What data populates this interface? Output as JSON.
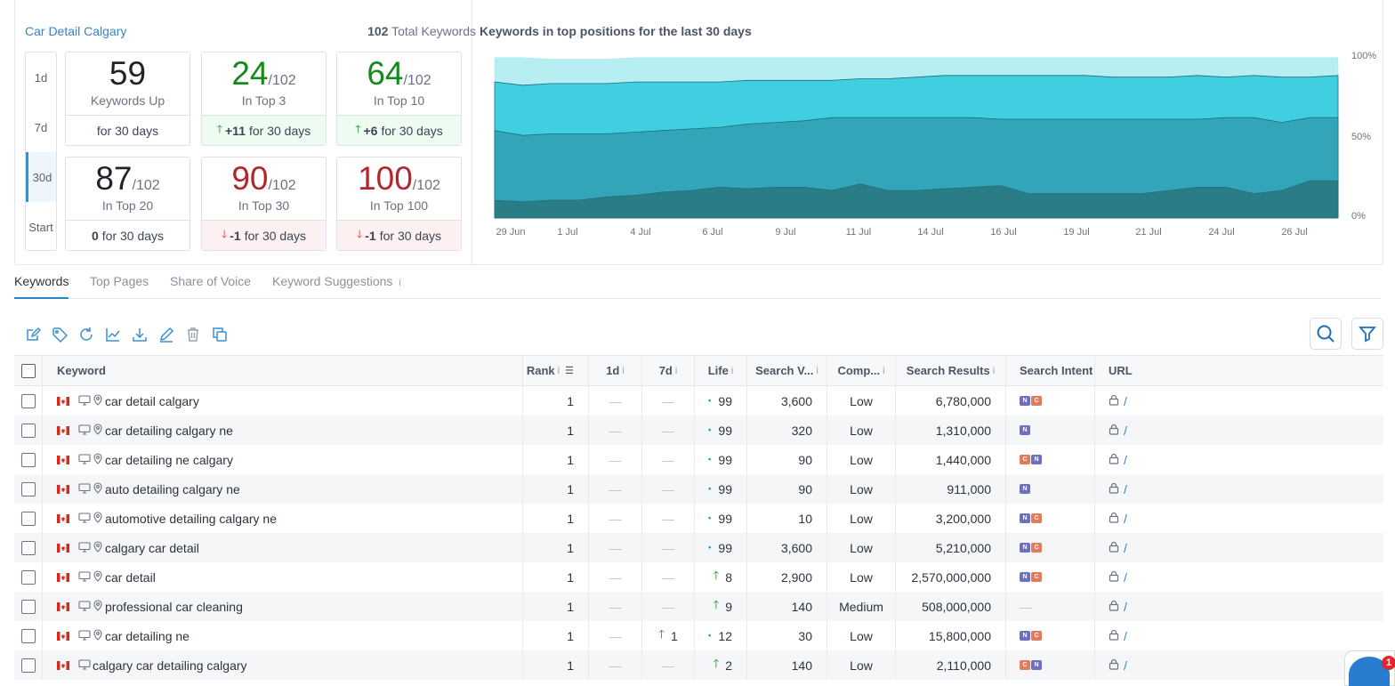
{
  "summary": {
    "project_name": "Car Detail Calgary",
    "total_count": "102",
    "total_label": "Total Keywords",
    "periods": [
      "1d",
      "7d",
      "30d",
      "Start"
    ],
    "active_period": "30d",
    "cards": [
      {
        "value": "59",
        "of": "",
        "label": "Keywords Up",
        "change": "",
        "change_text": "for 30 days",
        "direction": "none",
        "color": "black"
      },
      {
        "value": "24",
        "of": "/102",
        "label": "In Top 3",
        "change": "+11",
        "change_text": "for 30 days",
        "direction": "up",
        "color": "green"
      },
      {
        "value": "64",
        "of": "/102",
        "label": "In Top 10",
        "change": "+6",
        "change_text": "for 30 days",
        "direction": "up",
        "color": "green"
      },
      {
        "value": "87",
        "of": "/102",
        "label": "In Top 20",
        "change": "0",
        "change_text": "for 30 days",
        "direction": "none",
        "color": "black"
      },
      {
        "value": "90",
        "of": "/102",
        "label": "In Top 30",
        "change": "-1",
        "change_text": "for 30 days",
        "direction": "down",
        "color": "red"
      },
      {
        "value": "100",
        "of": "/102",
        "label": "In Top 100",
        "change": "-1",
        "change_text": "for 30 days",
        "direction": "down",
        "color": "red"
      }
    ]
  },
  "chart_data": {
    "type": "area",
    "title": "Keywords in top positions for the last 30 days",
    "x_tick_labels": [
      "29 Jun",
      "1 Jul",
      "4 Jul",
      "6 Jul",
      "9 Jul",
      "11 Jul",
      "14 Jul",
      "16 Jul",
      "19 Jul",
      "21 Jul",
      "24 Jul",
      "26 Jul"
    ],
    "y_tick_labels": [
      "100%",
      "50%",
      "0%"
    ],
    "ylim": [
      0,
      100
    ],
    "stacked_layers_percent": [
      {
        "values": [
          99,
          99,
          98,
          98,
          98,
          99,
          99,
          99,
          99,
          99,
          99,
          99,
          99,
          99,
          99,
          99,
          99,
          99,
          99,
          99,
          99,
          99,
          99,
          99,
          99,
          99,
          99,
          99,
          99,
          99,
          99
        ],
        "color": "#b6eef2"
      },
      {
        "values": [
          84,
          82,
          83,
          83,
          83,
          84,
          84,
          84,
          84,
          85,
          85,
          85,
          85,
          86,
          86,
          87,
          88,
          88,
          88,
          88,
          88,
          88,
          87,
          87,
          87,
          88,
          87,
          88,
          87,
          87,
          88
        ],
        "color": "#3fcfe0"
      },
      {
        "values": [
          54,
          51,
          52,
          52,
          52,
          53,
          54,
          55,
          56,
          58,
          59,
          60,
          62,
          62,
          62,
          62,
          62,
          62,
          61,
          61,
          61,
          61,
          61,
          61,
          61,
          61,
          62,
          62,
          59,
          62,
          62
        ],
        "color": "#33a5b8"
      },
      {
        "values": [
          11,
          10,
          11,
          11,
          13,
          14,
          16,
          17,
          19,
          18,
          19,
          19,
          17,
          21,
          17,
          17,
          18,
          19,
          20,
          15,
          15,
          15,
          15,
          15,
          17,
          19,
          19,
          15,
          17,
          23,
          23
        ],
        "color": "#2a7d87"
      }
    ]
  },
  "tabs": [
    "Keywords",
    "Top Pages",
    "Share of Voice",
    "Keyword Suggestions"
  ],
  "tab_info": "i",
  "toolbar_icons": [
    "edit-note-icon",
    "tag-icon",
    "refresh-icon",
    "chart-icon",
    "download-icon",
    "pencil-icon",
    "trash-icon",
    "copy-icon"
  ],
  "table": {
    "headers": {
      "keyword": "Keyword",
      "rank": "Rank",
      "d1": "1d",
      "d7": "7d",
      "life": "Life",
      "search_volume": "Search V...",
      "competition": "Comp...",
      "search_results": "Search Results",
      "search_intent": "Search Intent",
      "url": "URL"
    },
    "info_mark": "i",
    "dash": "—",
    "rows": [
      {
        "keyword": "car detail calgary",
        "location": true,
        "rank": "1",
        "d1": "",
        "d7": "",
        "life": "99",
        "life_up": false,
        "sv": "3,600",
        "comp": "Low",
        "sr": "6,780,000",
        "intent": [
          "N",
          "C"
        ],
        "url": "/"
      },
      {
        "keyword": "car detailing calgary ne",
        "location": true,
        "rank": "1",
        "d1": "",
        "d7": "",
        "life": "99",
        "life_up": false,
        "sv": "320",
        "comp": "Low",
        "sr": "1,310,000",
        "intent": [
          "N"
        ],
        "url": "/"
      },
      {
        "keyword": "car detailing ne calgary",
        "location": true,
        "rank": "1",
        "d1": "",
        "d7": "",
        "life": "99",
        "life_up": false,
        "sv": "90",
        "comp": "Low",
        "sr": "1,440,000",
        "intent": [
          "C",
          "N"
        ],
        "url": "/"
      },
      {
        "keyword": "auto detailing calgary ne",
        "location": true,
        "rank": "1",
        "d1": "",
        "d7": "",
        "life": "99",
        "life_up": false,
        "sv": "90",
        "comp": "Low",
        "sr": "911,000",
        "intent": [
          "N"
        ],
        "url": "/"
      },
      {
        "keyword": "automotive detailing calgary ne",
        "location": true,
        "rank": "1",
        "d1": "",
        "d7": "",
        "life": "99",
        "life_up": false,
        "sv": "10",
        "comp": "Low",
        "sr": "3,200,000",
        "intent": [
          "N",
          "C"
        ],
        "url": "/"
      },
      {
        "keyword": "calgary car detail",
        "location": true,
        "rank": "1",
        "d1": "",
        "d7": "",
        "life": "99",
        "life_up": false,
        "sv": "3,600",
        "comp": "Low",
        "sr": "5,210,000",
        "intent": [
          "N",
          "C"
        ],
        "url": "/"
      },
      {
        "keyword": "car detail",
        "location": true,
        "rank": "1",
        "d1": "",
        "d7": "",
        "life": "8",
        "life_up": true,
        "sv": "2,900",
        "comp": "Low",
        "sr": "2,570,000,000",
        "intent": [
          "N",
          "C"
        ],
        "url": "/"
      },
      {
        "keyword": "professional car cleaning",
        "location": true,
        "rank": "1",
        "d1": "",
        "d7": "",
        "life": "9",
        "life_up": true,
        "sv": "140",
        "comp": "Medium",
        "sr": "508,000,000",
        "intent": [],
        "url": "/"
      },
      {
        "keyword": "car detailing ne",
        "location": true,
        "rank": "1",
        "d1": "",
        "d7": "1",
        "life": "12",
        "life_up": false,
        "sv": "30",
        "comp": "Low",
        "sr": "15,800,000",
        "intent": [
          "N",
          "C"
        ],
        "url": "/"
      },
      {
        "keyword": "calgary car detailing calgary",
        "location": false,
        "rank": "1",
        "d1": "",
        "d7": "",
        "life": "2",
        "life_up": true,
        "sv": "140",
        "comp": "Low",
        "sr": "2,110,000",
        "intent": [
          "C",
          "N"
        ],
        "url": "/"
      }
    ]
  },
  "chat": {
    "badge_count": "1"
  }
}
